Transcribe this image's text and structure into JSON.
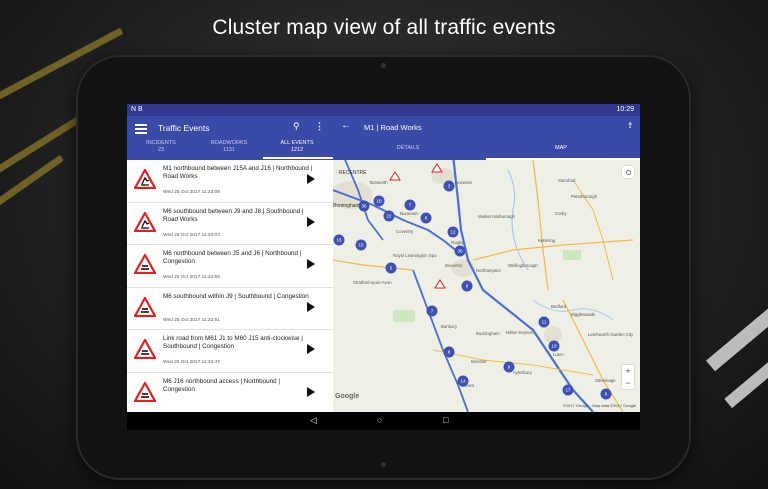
{
  "headline": "Cluster map view of all traffic events",
  "status_bar": {
    "left_icons": "N  B",
    "right_text": "10:29"
  },
  "left_panel": {
    "title": "Traffic Events",
    "tabs": [
      {
        "label": "INCIDENTS",
        "count": "23"
      },
      {
        "label": "ROADWORKS",
        "count": "1131"
      },
      {
        "label": "ALL EVENTS",
        "count": "1212"
      }
    ],
    "events": [
      {
        "title": "M1 northbound between J15A and J16 | Northbound | Road Works",
        "date": "Wed 25 Oct 2017 11:23:09"
      },
      {
        "title": "M6 southbound between J9 and J8 | Southbound | Road Works",
        "date": "Wed 25 Oct 2017 11:23:03"
      },
      {
        "title": "M6 northbound between J5 and J6 | Northbound | Congestion",
        "date": "Wed 25 Oct 2017 11:22:55"
      },
      {
        "title": "M6 southbound within J9 | Southbound | Congestion",
        "date": "Wed 25 Oct 2017 11:22:51"
      },
      {
        "title": "Link road from M61 J1 to M60 J15 anti-clockwise | Southbound | Congestion",
        "date": "Wed 25 Oct 2017 11:22:47"
      },
      {
        "title": "M6 J16 northbound access | Northbound | Congestion",
        "date": ""
      }
    ]
  },
  "right_panel": {
    "title": "M1 | Road Works",
    "tabs": [
      "DETAILS",
      "MAP"
    ],
    "map": {
      "places": [
        "RECENTRE",
        "Tamworth",
        "Leicester",
        "Birmingham",
        "Nuneaton",
        "Coventry",
        "Royal Leamington Spa",
        "Rugby",
        "Market Harborough",
        "Northampton",
        "Daventry",
        "Wellingborough",
        "Banbury",
        "Buckingham",
        "Bedford",
        "Milton Keynes",
        "Luton",
        "Oxford",
        "Peterborough",
        "Stamford",
        "Corby",
        "Kettering",
        "Stratford-upon-Avon",
        "Bicester",
        "Aylesbury",
        "Stevenage",
        "Biggleswade",
        "Letchworth Garden City"
      ],
      "clusters": [
        "3",
        "7",
        "22",
        "10",
        "36",
        "30",
        "8",
        "12",
        "15",
        "5",
        "16",
        "8",
        "11",
        "7",
        "8",
        "13",
        "17",
        "14",
        "6",
        "9"
      ],
      "google_label": "Google",
      "attribution": "©2017 Google · Map data ©2017 Google"
    }
  },
  "nav_bar": {
    "back": "◁",
    "home": "○",
    "recents": "□"
  }
}
